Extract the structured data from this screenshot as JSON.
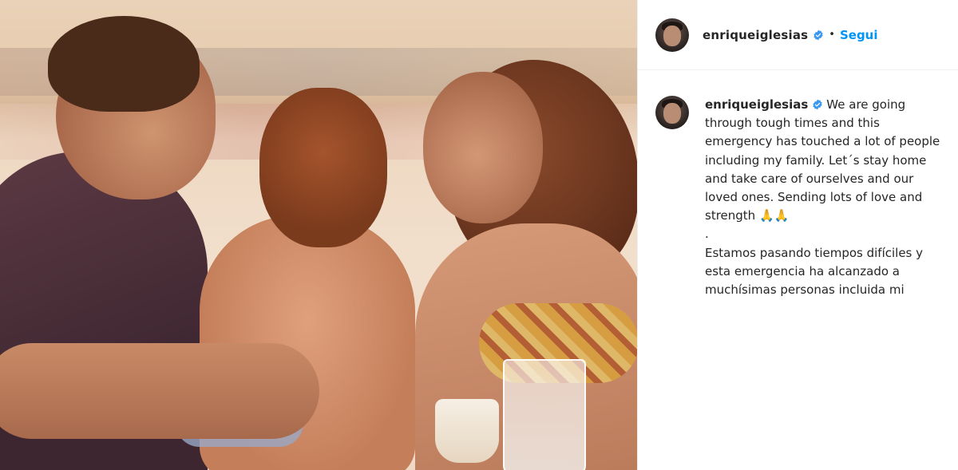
{
  "post": {
    "author": {
      "username": "enriqueiglesias",
      "verified": true,
      "avatar_icon": "profile-avatar"
    },
    "header": {
      "separator": "•",
      "follow_label": "Segui"
    },
    "caption": {
      "username": "enriqueiglesias",
      "text_en": "We are going through tough times and this emergency has touched a lot of people including my family. Let´s stay home and take care of ourselves and our loved ones. Sending lots of love and strength",
      "emoji": "🙏🙏",
      "divider": ".",
      "text_es": "Estamos pasando tiempos difíciles y esta emergencia ha alcanzado a muchísimas personas incluida mi"
    },
    "colors": {
      "accent": "#0095f6",
      "text": "#262626",
      "border": "#efefef"
    }
  }
}
